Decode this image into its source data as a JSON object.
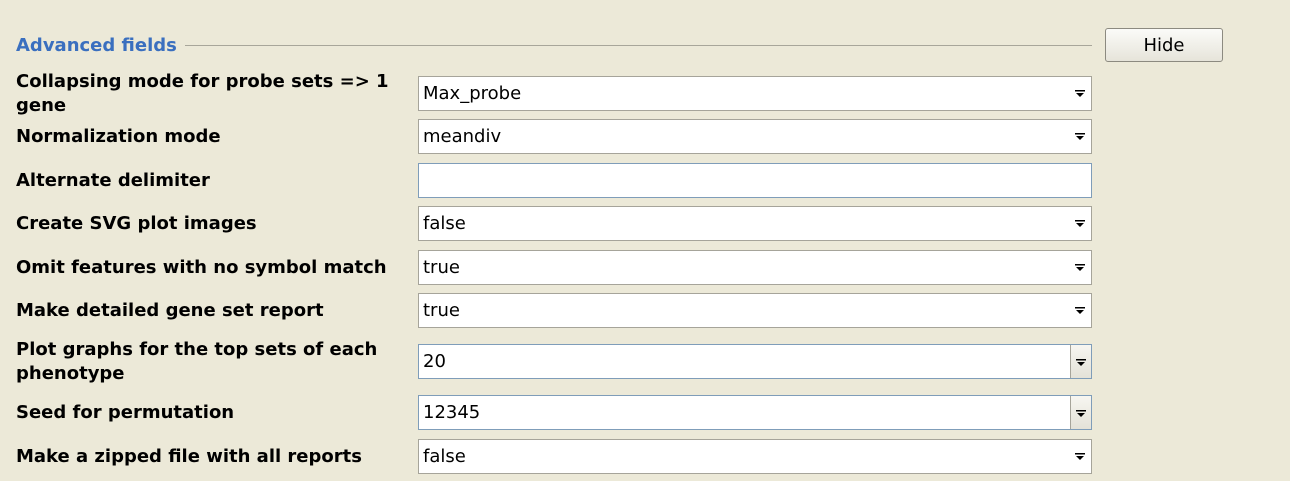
{
  "section": {
    "title": "Advanced fields",
    "hide_label": "Hide"
  },
  "fields": [
    {
      "label": "Collapsing mode for probe sets => 1 gene",
      "value": "Max_probe",
      "control": "select"
    },
    {
      "label": "Normalization mode",
      "value": "meandiv",
      "control": "select"
    },
    {
      "label": "Alternate delimiter",
      "value": "",
      "control": "text"
    },
    {
      "label": "Create SVG plot images",
      "value": "false",
      "control": "select"
    },
    {
      "label": "Omit features with no symbol match",
      "value": "true",
      "control": "select"
    },
    {
      "label": "Make detailed gene set report",
      "value": "true",
      "control": "select"
    },
    {
      "label": "Plot graphs for the top sets of each phenotype",
      "value": "20",
      "control": "combo"
    },
    {
      "label": "Seed for permutation",
      "value": "12345",
      "control": "combo"
    },
    {
      "label": "Make a zipped file with all reports",
      "value": "false",
      "control": "select"
    }
  ],
  "icons": {
    "select_arrow": "dropdown-arrow-icon",
    "combo_arrow": "dropdown-arrow-icon"
  }
}
